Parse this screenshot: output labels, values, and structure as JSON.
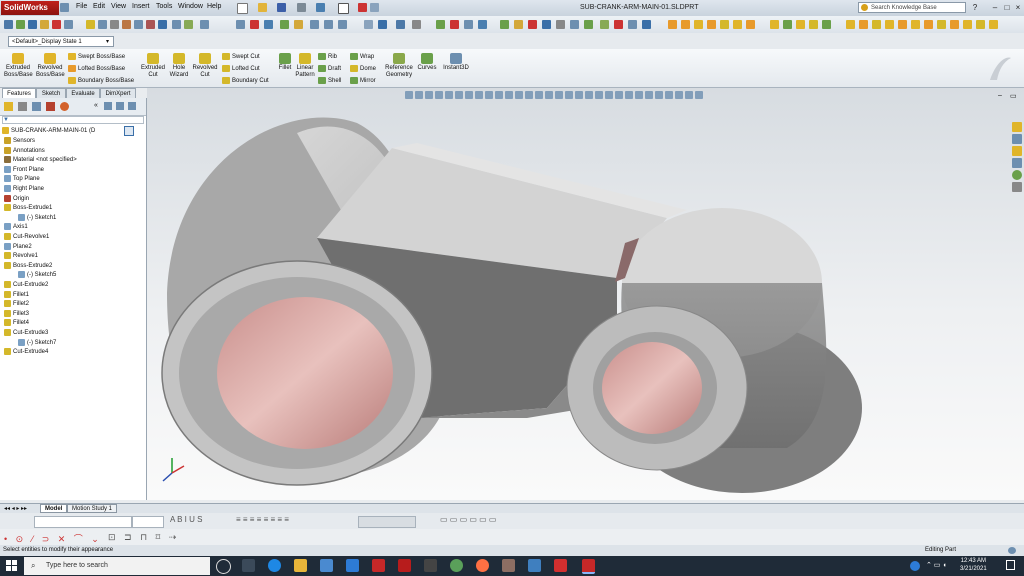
{
  "app": {
    "name": "SolidWorks",
    "document_title": "SUB-CRANK-ARM-MAIN-01.SLDPRT"
  },
  "menu": [
    "File",
    "Edit",
    "View",
    "Insert",
    "Tools",
    "Window",
    "Help"
  ],
  "search": {
    "placeholder": "Search Knowledge Base"
  },
  "config": {
    "selected": "<Default>_Display State 1"
  },
  "commands": {
    "extruded_boss": "Extruded Boss/Base",
    "revolved_boss": "Revolved Boss/Base",
    "swept_boss": "Swept Boss/Base",
    "lofted_boss": "Lofted Boss/Base",
    "boundary_boss": "Boundary Boss/Base",
    "extruded_cut": "Extruded Cut",
    "hole_wizard": "Hole Wizard",
    "revolved_cut": "Revolved Cut",
    "swept_cut": "Swept Cut",
    "lofted_cut": "Lofted Cut",
    "boundary_cut": "Boundary Cut",
    "fillet": "Fillet",
    "linear_pattern": "Linear Pattern",
    "rib": "Rib",
    "draft": "Draft",
    "shell": "Shell",
    "wrap": "Wrap",
    "dome": "Dome",
    "mirror": "Mirror",
    "reference_geometry": "Reference Geometry",
    "curves": "Curves",
    "instant3d": "Instant3D"
  },
  "panel_tabs": [
    "Features",
    "Sketch",
    "Evaluate",
    "DimXpert"
  ],
  "tree": {
    "root": "SUB-CRANK-ARM-MAIN-01 (D",
    "items": [
      {
        "label": "Sensors",
        "indent": 1,
        "color": "#c9a227"
      },
      {
        "label": "Annotations",
        "indent": 1,
        "color": "#c9a227"
      },
      {
        "label": "Material <not specified>",
        "indent": 1,
        "color": "#8a6d3b"
      },
      {
        "label": "Front Plane",
        "indent": 1,
        "color": "#7aa0c4"
      },
      {
        "label": "Top Plane",
        "indent": 1,
        "color": "#7aa0c4"
      },
      {
        "label": "Right Plane",
        "indent": 1,
        "color": "#7aa0c4"
      },
      {
        "label": "Origin",
        "indent": 1,
        "color": "#b5412f"
      },
      {
        "label": "Boss-Extrude1",
        "indent": 1,
        "color": "#d4b82a"
      },
      {
        "label": "(-) Sketch1",
        "indent": 2,
        "color": "#7aa0c4"
      },
      {
        "label": "Axis1",
        "indent": 1,
        "color": "#7aa0c4"
      },
      {
        "label": "Cut-Revolve1",
        "indent": 1,
        "color": "#d4b82a"
      },
      {
        "label": "Plane2",
        "indent": 1,
        "color": "#7aa0c4"
      },
      {
        "label": "Revolve1",
        "indent": 1,
        "color": "#d4b82a"
      },
      {
        "label": "Boss-Extrude2",
        "indent": 1,
        "color": "#d4b82a"
      },
      {
        "label": "(-) Sketch5",
        "indent": 2,
        "color": "#7aa0c4"
      },
      {
        "label": "Cut-Extrude2",
        "indent": 1,
        "color": "#d4b82a"
      },
      {
        "label": "Fillet1",
        "indent": 1,
        "color": "#d4b82a"
      },
      {
        "label": "Fillet2",
        "indent": 1,
        "color": "#d4b82a"
      },
      {
        "label": "Fillet3",
        "indent": 1,
        "color": "#d4b82a"
      },
      {
        "label": "Fillet4",
        "indent": 1,
        "color": "#d4b82a"
      },
      {
        "label": "Cut-Extrude3",
        "indent": 1,
        "color": "#d4b82a"
      },
      {
        "label": "(-) Sketch7",
        "indent": 2,
        "color": "#7aa0c4"
      },
      {
        "label": "Cut-Extrude4",
        "indent": 1,
        "color": "#d4b82a"
      }
    ]
  },
  "bottom_tabs": [
    "Model",
    "Motion Study 1"
  ],
  "status": {
    "message": "Select entities to modify their appearance",
    "mode": "Editing Part"
  },
  "taskbar": {
    "search_placeholder": "Type here to search",
    "time": "12:43 AM",
    "date": "3/21/2021"
  },
  "colors": {
    "brand": "#b3201a",
    "model_body": "#c8c8c8",
    "bore_face": "#d9a7a3"
  }
}
